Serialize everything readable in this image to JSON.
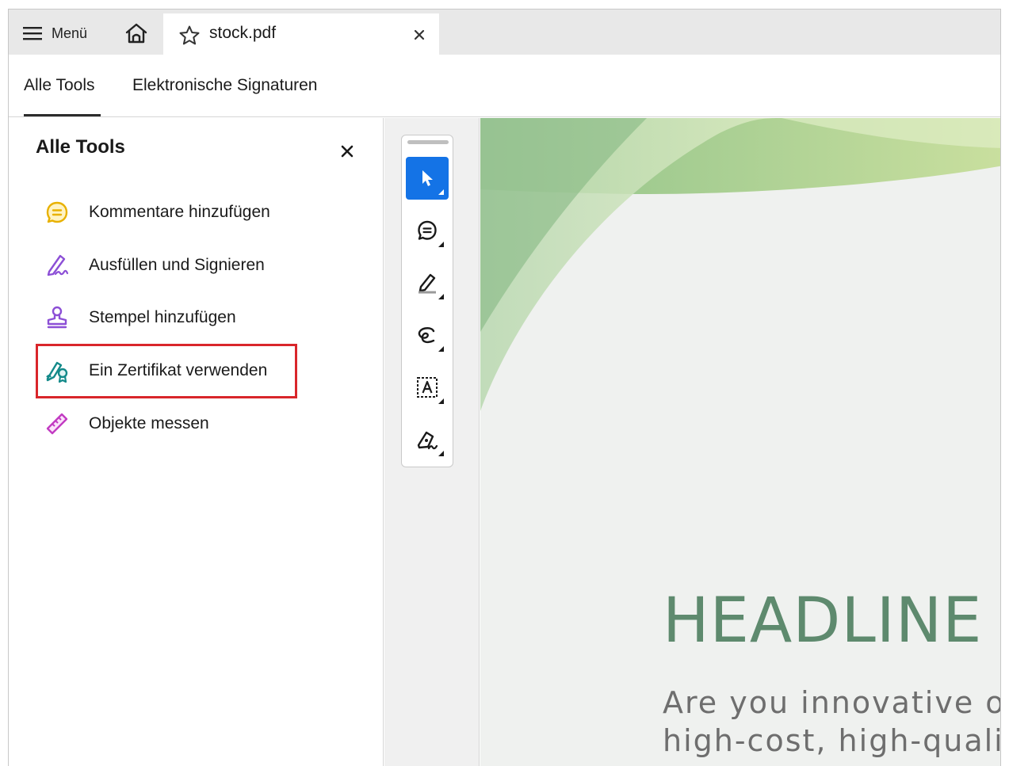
{
  "tabbar": {
    "menu_label": "Menü",
    "document_tab_title": "stock.pdf"
  },
  "subtabs": [
    "Alle Tools",
    "Elektronische Signaturen"
  ],
  "panel": {
    "title": "Alle Tools",
    "tools": [
      {
        "label": "Kommentare hinzufügen",
        "icon": "comment-icon",
        "color": "#e8b100"
      },
      {
        "label": "Ausfüllen und Signieren",
        "icon": "fill-sign-icon",
        "color": "#8c4fd6"
      },
      {
        "label": "Stempel hinzufügen",
        "icon": "stamp-icon",
        "color": "#8c4fd6"
      },
      {
        "label": "Ein Zertifikat verwenden",
        "icon": "certificate-icon",
        "color": "#148a8a",
        "highlighted": true
      },
      {
        "label": "Objekte messen",
        "icon": "ruler-icon",
        "color": "#c23bc2"
      }
    ]
  },
  "vertical_toolbar": [
    {
      "name": "select-tool",
      "icon": "cursor-icon",
      "active": true
    },
    {
      "name": "comment-tool",
      "icon": "comment-icon"
    },
    {
      "name": "highlight-tool",
      "icon": "highlighter-icon"
    },
    {
      "name": "draw-tool",
      "icon": "freeform-icon"
    },
    {
      "name": "text-tool",
      "icon": "text-box-icon"
    },
    {
      "name": "sign-tool",
      "icon": "pen-sign-icon"
    }
  ],
  "document": {
    "headline": "HEADLINE",
    "line1": "Are you innovative or",
    "line2": "high-cost, high-qualit"
  },
  "colors": {
    "accent": "#1473e6",
    "highlight_border": "#d9262b",
    "headline": "#5e8a6e"
  }
}
